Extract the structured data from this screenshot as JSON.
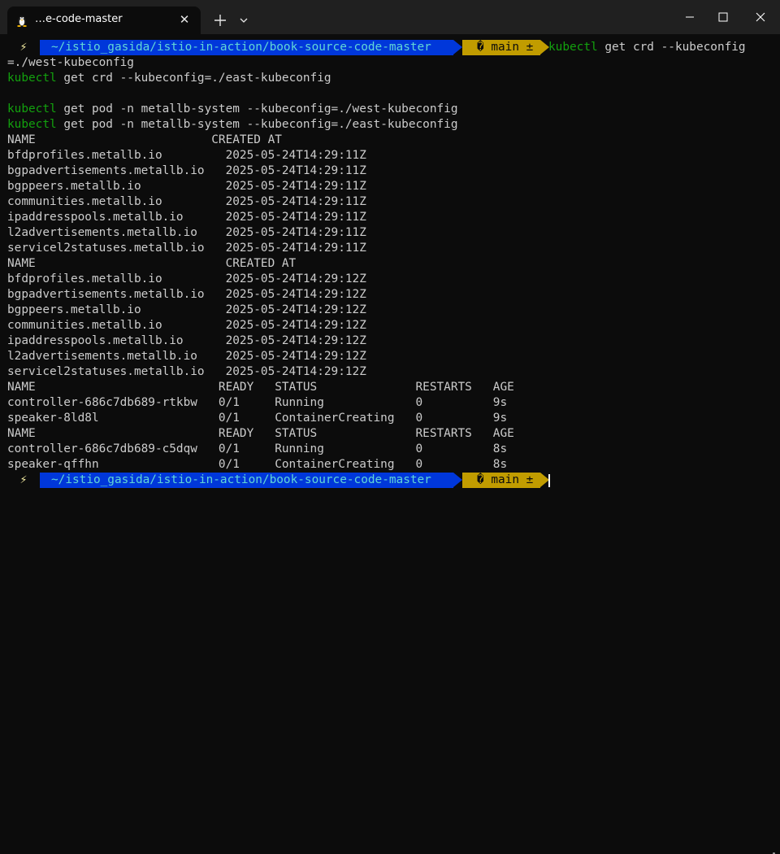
{
  "window": {
    "tab_title": "…e-code-master",
    "tab_icon": "linux-penguin-icon",
    "new_tab_icon": "plus-icon",
    "dropdown_icon": "chevron-down-icon",
    "controls": [
      "minimize-icon",
      "maximize-icon",
      "close-icon"
    ]
  },
  "prompt": {
    "bolt": "⚡",
    "path": "~/istio_gasida/istio-in-action/book-source-code-master",
    "branch": "� main ±",
    "colors": {
      "path_bg": "#0037da",
      "path_fg": "#61d6d6",
      "git_bg": "#c19c00",
      "cmd": "#13a10e"
    }
  },
  "terminal": {
    "first_command_rest": " get crd --kubeconfig",
    "commands": [
      {
        "cmd": "kubectl",
        "args": " get crd --kubeconfig"
      },
      {
        "cmd": "",
        "args": "=./west-kubeconfig"
      },
      {
        "cmd": "kubectl",
        "args": " get crd --kubeconfig=./east-kubeconfig"
      },
      {
        "cmd": "",
        "args": ""
      },
      {
        "cmd": "kubectl",
        "args": " get pod -n metallb-system --kubeconfig=./west-kubeconfig"
      },
      {
        "cmd": "kubectl",
        "args": " get pod -n metallb-system --kubeconfig=./east-kubeconfig"
      }
    ],
    "output_lines": [
      "NAME                         CREATED AT",
      "bfdprofiles.metallb.io         2025-05-24T14:29:11Z",
      "bgpadvertisements.metallb.io   2025-05-24T14:29:11Z",
      "bgppeers.metallb.io            2025-05-24T14:29:11Z",
      "communities.metallb.io         2025-05-24T14:29:11Z",
      "ipaddresspools.metallb.io      2025-05-24T14:29:11Z",
      "l2advertisements.metallb.io    2025-05-24T14:29:11Z",
      "servicel2statuses.metallb.io   2025-05-24T14:29:11Z",
      "NAME                           CREATED AT",
      "bfdprofiles.metallb.io         2025-05-24T14:29:12Z",
      "bgpadvertisements.metallb.io   2025-05-24T14:29:12Z",
      "bgppeers.metallb.io            2025-05-24T14:29:12Z",
      "communities.metallb.io         2025-05-24T14:29:12Z",
      "ipaddresspools.metallb.io      2025-05-24T14:29:12Z",
      "l2advertisements.metallb.io    2025-05-24T14:29:12Z",
      "servicel2statuses.metallb.io   2025-05-24T14:29:12Z",
      "NAME                          READY   STATUS              RESTARTS   AGE",
      "controller-686c7db689-rtkbw   0/1     Running             0          9s",
      "speaker-8ld8l                 0/1     ContainerCreating   0          9s",
      "NAME                          READY   STATUS              RESTARTS   AGE",
      "controller-686c7db689-c5dqw   0/1     Running             0          8s",
      "speaker-qffhn                 0/1     ContainerCreating   0          8s"
    ]
  }
}
